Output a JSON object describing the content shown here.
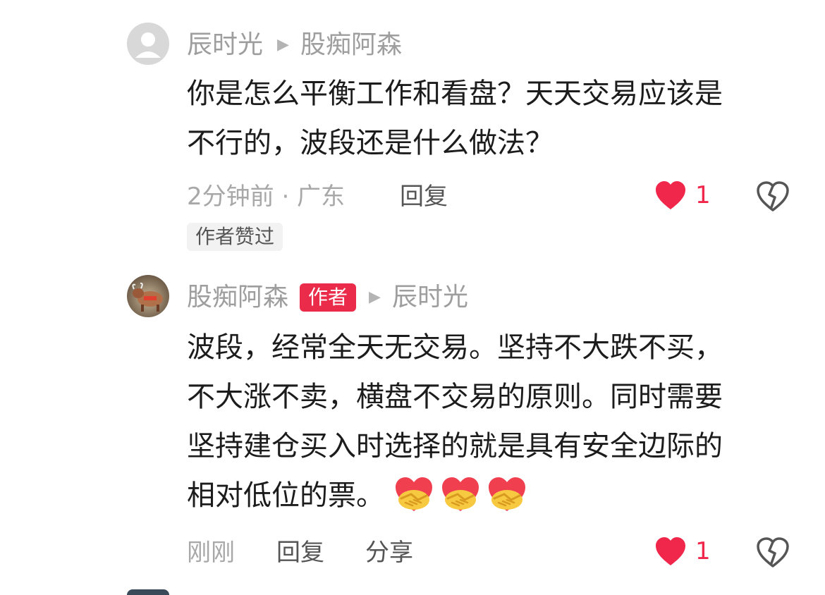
{
  "comment1": {
    "username": "辰时光",
    "reply_to": "股痴阿森",
    "text_line1": "你是怎么平衡工作和看盘？天天交易应该是",
    "text_line2": "不行的，波段还是什么做法？",
    "time_location": "2分钟前 · 广东",
    "reply_label": "回复",
    "like_count": "1",
    "author_liked_badge": "作者赞过"
  },
  "comment2": {
    "username": "股痴阿森",
    "author_badge": "作者",
    "reply_to": "辰时光",
    "text_line1": "波段，经常全天无交易。坚持不大跌不买，",
    "text_line2": "不大涨不卖，横盘不交易的原则。同时需要",
    "text_line3": "坚持建仓买入时选择的就是具有安全边际的",
    "text_line4": "相对低位的票。",
    "emojis": [
      "handshake-heart-emoji",
      "handshake-heart-emoji",
      "handshake-heart-emoji"
    ],
    "time": "刚刚",
    "reply_label": "回复",
    "share_label": "分享",
    "like_count": "1"
  },
  "colors": {
    "accent_red": "#f0264a",
    "name_gray": "#9e9e9e",
    "text_dark": "#1c1c1c"
  }
}
